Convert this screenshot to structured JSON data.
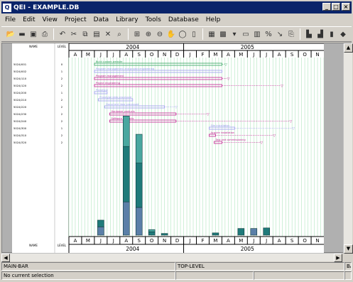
{
  "window": {
    "title": "QEI - EXAMPLE.DB",
    "app_icon": "Q"
  },
  "menu": [
    "File",
    "Edit",
    "View",
    "Project",
    "Data",
    "Library",
    "Tools",
    "Database",
    "Help"
  ],
  "toolbar_icons": [
    "open-folder-icon",
    "new-icon",
    "save-icon",
    "print-icon",
    "undo-icon",
    "cut-icon",
    "copy-icon",
    "paste-icon",
    "delete-icon",
    "find-icon",
    "zoom-fit-icon",
    "zoom-in-icon",
    "zoom-out-icon",
    "pan-icon",
    "zoom-window-icon",
    "page-icon",
    "grid-icon",
    "chart-icon",
    "filter-icon",
    "layout-icon",
    "table-icon",
    "percent-icon",
    "link-icon",
    "attach-icon",
    "bar-chart-icon",
    "bar-chart2-icon",
    "bookmark-icon"
  ],
  "left_columns": {
    "col1": "NAME",
    "col2": "LEVEL"
  },
  "timeline": {
    "years": [
      "2004",
      "2005"
    ],
    "months": [
      "A",
      "M",
      "J",
      "J",
      "A",
      "S",
      "O",
      "N",
      "D",
      "J",
      "F",
      "M",
      "A",
      "M",
      "J",
      "J",
      "A",
      "S",
      "O",
      "N"
    ]
  },
  "rows": [
    {
      "id": "5024/001",
      "level": "0",
      "label": "Build custom website"
    },
    {
      "id": "5024/002",
      "level": "1",
      "label": "Program management and project engineering"
    },
    {
      "id": "5024/110",
      "level": "2",
      "label": "Program management"
    },
    {
      "id": "5024/120",
      "level": "2",
      "label": "Project engineering"
    },
    {
      "id": "5024/200",
      "level": "1",
      "label": "Prototype"
    },
    {
      "id": "5024/210",
      "level": "2",
      "label": "Prototype data processed"
    },
    {
      "id": "5024/220",
      "level": "2",
      "label": "Document data processed"
    },
    {
      "id": "5024/230",
      "level": "2",
      "label": "Hardware products"
    },
    {
      "id": "5024/240",
      "level": "2",
      "label": "Software products"
    },
    {
      "id": "5024/300",
      "level": "1",
      "label": "Site installation"
    },
    {
      "id": "5024/310",
      "level": "2",
      "label": "Acquire installation"
    },
    {
      "id": "5024/320",
      "level": "2",
      "label": "Test and commissioning"
    }
  ],
  "histogram": {
    "months_index": [
      2,
      3,
      4,
      5,
      6,
      7,
      8,
      9,
      10,
      11,
      12,
      13,
      14,
      15
    ],
    "bottom": [
      1.5,
      0,
      6,
      5,
      0,
      0,
      0,
      0,
      0,
      0,
      0,
      0,
      1.2,
      0
    ],
    "middle": [
      1.2,
      0,
      10,
      8,
      0.6,
      0.3,
      0,
      0,
      0,
      0.4,
      0,
      1.2,
      0,
      1.3
    ],
    "top": [
      0,
      0,
      5.5,
      5.2,
      0.4,
      0,
      0,
      0,
      0,
      0,
      0,
      0,
      0,
      0
    ]
  },
  "status": {
    "row1_left": "MAIN-BAR",
    "row1_mid": "TOP-LEVEL",
    "row1_right": "BAR",
    "row2_left": "No current selection"
  }
}
